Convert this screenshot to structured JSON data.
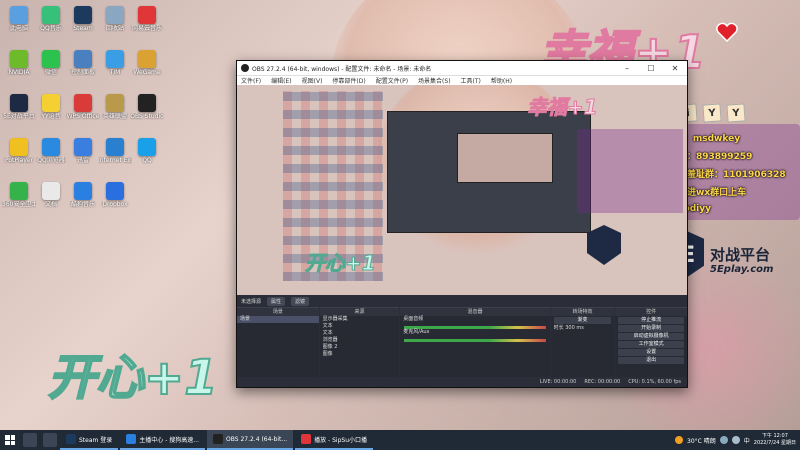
{
  "desktop": {
    "icons": [
      {
        "label": "此电脑",
        "color": "#5aa0e0"
      },
      {
        "label": "QQ音乐",
        "color": "#36c07a"
      },
      {
        "label": "Steam",
        "color": "#1b3a5e"
      },
      {
        "label": "回收站",
        "color": "#8aa6c0"
      },
      {
        "label": "网易云音乐",
        "color": "#e0363a"
      },
      {
        "label": "NVIDIA",
        "color": "#6dbb2a"
      },
      {
        "label": "微信",
        "color": "#2dc14e"
      },
      {
        "label": "控制面板",
        "color": "#4a7fc0"
      },
      {
        "label": "TIM",
        "color": "#3a9ee4"
      },
      {
        "label": "WeGame",
        "color": "#d9a232"
      },
      {
        "label": "5E对战平台",
        "color": "#1e2a44"
      },
      {
        "label": "YY语音",
        "color": "#f5d033"
      },
      {
        "label": "WPS Office",
        "color": "#d93a3a"
      },
      {
        "label": "英雄联盟",
        "color": "#b89a4a"
      },
      {
        "label": "OBS Studio",
        "color": "#222222"
      },
      {
        "label": "PotPlayer",
        "color": "#f0c020"
      },
      {
        "label": "QQ浏览器",
        "color": "#2a8ae0"
      },
      {
        "label": "迅雷",
        "color": "#3a7ee0"
      },
      {
        "label": "Internet Explorer",
        "color": "#2a80d0"
      },
      {
        "label": "QQ",
        "color": "#1aa0e8"
      },
      {
        "label": "360安全卫士",
        "color": "#35b24a"
      },
      {
        "label": "文档",
        "color": "#e9e9e9"
      },
      {
        "label": "酷狗音乐",
        "color": "#2a80e0"
      },
      {
        "label": "Dropbox",
        "color": "#2a6fe0"
      }
    ]
  },
  "decorations": {
    "xingfu": "幸福+1",
    "kaixin": "开心+1"
  },
  "right_panel": {
    "diy": [
      "D",
      "i",
      "Y",
      "Y"
    ],
    "lines": [
      {
        "text": "欧皇v：msdwkey",
        "color": "#f5c542"
      },
      {
        "text": "欧皇群：893899259",
        "color": "#e04a4a"
      },
      {
        "text": "颠人杰羞耻群：1101906328",
        "color": "#e04a4a"
      },
      {
        "text": "钻粉可进wx群口上车",
        "color": "#2aa0e8"
      },
      {
        "text": "/  csgodiyy",
        "color": "#e04a4a"
      }
    ],
    "logo_badge": "5E",
    "logo_title": "对战平台",
    "logo_sub": "5Eplay.com"
  },
  "obs": {
    "title": "OBS 27.2.4 (64-bit, windows) - 配置文件: 未命名 - 场景: 未命名",
    "window_buttons": [
      "–",
      "☐",
      "✕"
    ],
    "menu": [
      "文件(F)",
      "编辑(E)",
      "视图(V)",
      "停靠部件(D)",
      "配置文件(P)",
      "场景集合(S)",
      "工具(T)",
      "帮助(H)"
    ],
    "no_source": "未选择源",
    "bar_buttons": [
      "属性",
      "滤镜"
    ],
    "docks": {
      "scenes": {
        "title": "场景",
        "items": [
          "场景"
        ]
      },
      "sources": {
        "title": "来源",
        "items": [
          "显示器采集",
          "文本",
          "文本",
          "浏览器",
          "图像 2",
          "图像"
        ]
      },
      "mixer": {
        "title": "混音器",
        "channels": [
          "桌面音频",
          "麦克风/Aux"
        ]
      },
      "transitions": {
        "title": "转场特效",
        "type": "渐变",
        "duration_label": "时长",
        "duration": "300 ms"
      },
      "controls": {
        "title": "控件",
        "buttons": [
          "停止推流",
          "开始录制",
          "启动虚拟摄像机",
          "工作室模式",
          "设置",
          "退出"
        ]
      }
    },
    "status": {
      "live": "LIVE: 00:00:00",
      "rec": "REC: 00:00:00",
      "cpu": "CPU: 0.1%, 60.00 fps"
    }
  },
  "taskbar": {
    "apps": [
      {
        "label": "Steam 登录",
        "color": "#1b3a5e",
        "active": false
      },
      {
        "label": "主播中心 - 搜狗高速...",
        "color": "#2a80e0",
        "active": false
      },
      {
        "label": "OBS 27.2.4 (64-bit...",
        "color": "#222222",
        "active": true
      },
      {
        "label": "播放 - SipSu小口播",
        "color": "#e0363a",
        "active": false
      }
    ],
    "weather": "30°C 晴朗",
    "ime": "中",
    "time": "下午 12:07",
    "date": "2022/7/24 星期日"
  }
}
